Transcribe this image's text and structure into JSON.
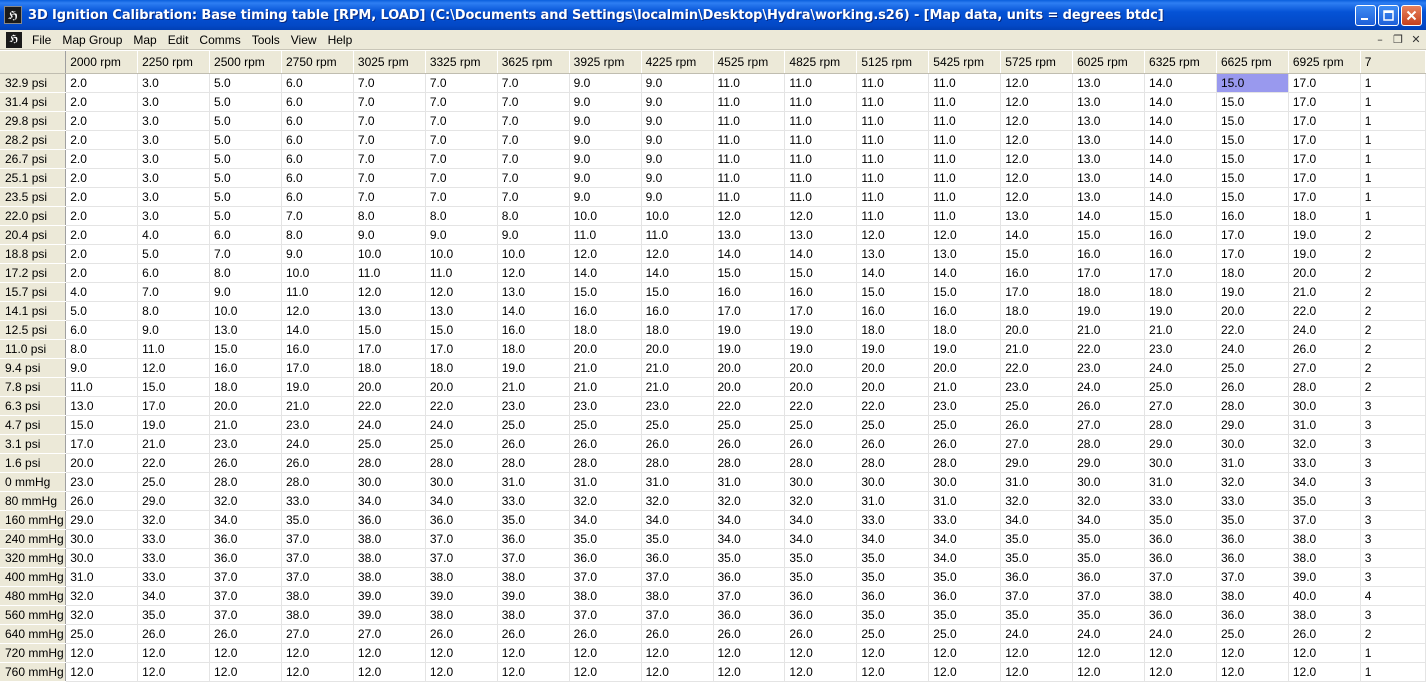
{
  "window": {
    "title": "3D Ignition Calibration: Base timing table [RPM, LOAD]  (C:\\Documents and Settings\\localmin\\Desktop\\Hydra\\working.s26) - [Map data, units = degrees btdc]"
  },
  "menu": [
    "File",
    "Map Group",
    "Map",
    "Edit",
    "Comms",
    "Tools",
    "View",
    "Help"
  ],
  "grid": {
    "columns": [
      "2000 rpm",
      "2250 rpm",
      "2500 rpm",
      "2750 rpm",
      "3025 rpm",
      "3325 rpm",
      "3625 rpm",
      "3925 rpm",
      "4225 rpm",
      "4525 rpm",
      "4825 rpm",
      "5125 rpm",
      "5425 rpm",
      "5725 rpm",
      "6025 rpm",
      "6325 rpm",
      "6625 rpm",
      "6925 rpm",
      "7"
    ],
    "selected": {
      "row": 0,
      "col": 16
    },
    "rows": [
      {
        "label": "32.9 psi",
        "values": [
          "2.0",
          "3.0",
          "5.0",
          "6.0",
          "7.0",
          "7.0",
          "7.0",
          "9.0",
          "9.0",
          "11.0",
          "11.0",
          "11.0",
          "11.0",
          "12.0",
          "13.0",
          "14.0",
          "15.0",
          "17.0",
          "1"
        ]
      },
      {
        "label": "31.4 psi",
        "values": [
          "2.0",
          "3.0",
          "5.0",
          "6.0",
          "7.0",
          "7.0",
          "7.0",
          "9.0",
          "9.0",
          "11.0",
          "11.0",
          "11.0",
          "11.0",
          "12.0",
          "13.0",
          "14.0",
          "15.0",
          "17.0",
          "1"
        ]
      },
      {
        "label": "29.8 psi",
        "values": [
          "2.0",
          "3.0",
          "5.0",
          "6.0",
          "7.0",
          "7.0",
          "7.0",
          "9.0",
          "9.0",
          "11.0",
          "11.0",
          "11.0",
          "11.0",
          "12.0",
          "13.0",
          "14.0",
          "15.0",
          "17.0",
          "1"
        ]
      },
      {
        "label": "28.2 psi",
        "values": [
          "2.0",
          "3.0",
          "5.0",
          "6.0",
          "7.0",
          "7.0",
          "7.0",
          "9.0",
          "9.0",
          "11.0",
          "11.0",
          "11.0",
          "11.0",
          "12.0",
          "13.0",
          "14.0",
          "15.0",
          "17.0",
          "1"
        ]
      },
      {
        "label": "26.7 psi",
        "values": [
          "2.0",
          "3.0",
          "5.0",
          "6.0",
          "7.0",
          "7.0",
          "7.0",
          "9.0",
          "9.0",
          "11.0",
          "11.0",
          "11.0",
          "11.0",
          "12.0",
          "13.0",
          "14.0",
          "15.0",
          "17.0",
          "1"
        ]
      },
      {
        "label": "25.1 psi",
        "values": [
          "2.0",
          "3.0",
          "5.0",
          "6.0",
          "7.0",
          "7.0",
          "7.0",
          "9.0",
          "9.0",
          "11.0",
          "11.0",
          "11.0",
          "11.0",
          "12.0",
          "13.0",
          "14.0",
          "15.0",
          "17.0",
          "1"
        ]
      },
      {
        "label": "23.5 psi",
        "values": [
          "2.0",
          "3.0",
          "5.0",
          "6.0",
          "7.0",
          "7.0",
          "7.0",
          "9.0",
          "9.0",
          "11.0",
          "11.0",
          "11.0",
          "11.0",
          "12.0",
          "13.0",
          "14.0",
          "15.0",
          "17.0",
          "1"
        ]
      },
      {
        "label": "22.0 psi",
        "values": [
          "2.0",
          "3.0",
          "5.0",
          "7.0",
          "8.0",
          "8.0",
          "8.0",
          "10.0",
          "10.0",
          "12.0",
          "12.0",
          "11.0",
          "11.0",
          "13.0",
          "14.0",
          "15.0",
          "16.0",
          "18.0",
          "1"
        ]
      },
      {
        "label": "20.4 psi",
        "values": [
          "2.0",
          "4.0",
          "6.0",
          "8.0",
          "9.0",
          "9.0",
          "9.0",
          "11.0",
          "11.0",
          "13.0",
          "13.0",
          "12.0",
          "12.0",
          "14.0",
          "15.0",
          "16.0",
          "17.0",
          "19.0",
          "2"
        ]
      },
      {
        "label": "18.8 psi",
        "values": [
          "2.0",
          "5.0",
          "7.0",
          "9.0",
          "10.0",
          "10.0",
          "10.0",
          "12.0",
          "12.0",
          "14.0",
          "14.0",
          "13.0",
          "13.0",
          "15.0",
          "16.0",
          "16.0",
          "17.0",
          "19.0",
          "2"
        ]
      },
      {
        "label": "17.2 psi",
        "values": [
          "2.0",
          "6.0",
          "8.0",
          "10.0",
          "11.0",
          "11.0",
          "12.0",
          "14.0",
          "14.0",
          "15.0",
          "15.0",
          "14.0",
          "14.0",
          "16.0",
          "17.0",
          "17.0",
          "18.0",
          "20.0",
          "2"
        ]
      },
      {
        "label": "15.7 psi",
        "values": [
          "4.0",
          "7.0",
          "9.0",
          "11.0",
          "12.0",
          "12.0",
          "13.0",
          "15.0",
          "15.0",
          "16.0",
          "16.0",
          "15.0",
          "15.0",
          "17.0",
          "18.0",
          "18.0",
          "19.0",
          "21.0",
          "2"
        ]
      },
      {
        "label": "14.1 psi",
        "values": [
          "5.0",
          "8.0",
          "10.0",
          "12.0",
          "13.0",
          "13.0",
          "14.0",
          "16.0",
          "16.0",
          "17.0",
          "17.0",
          "16.0",
          "16.0",
          "18.0",
          "19.0",
          "19.0",
          "20.0",
          "22.0",
          "2"
        ]
      },
      {
        "label": "12.5 psi",
        "values": [
          "6.0",
          "9.0",
          "13.0",
          "14.0",
          "15.0",
          "15.0",
          "16.0",
          "18.0",
          "18.0",
          "19.0",
          "19.0",
          "18.0",
          "18.0",
          "20.0",
          "21.0",
          "21.0",
          "22.0",
          "24.0",
          "2"
        ]
      },
      {
        "label": "11.0 psi",
        "values": [
          "8.0",
          "11.0",
          "15.0",
          "16.0",
          "17.0",
          "17.0",
          "18.0",
          "20.0",
          "20.0",
          "19.0",
          "19.0",
          "19.0",
          "19.0",
          "21.0",
          "22.0",
          "23.0",
          "24.0",
          "26.0",
          "2"
        ]
      },
      {
        "label": "9.4 psi",
        "values": [
          "9.0",
          "12.0",
          "16.0",
          "17.0",
          "18.0",
          "18.0",
          "19.0",
          "21.0",
          "21.0",
          "20.0",
          "20.0",
          "20.0",
          "20.0",
          "22.0",
          "23.0",
          "24.0",
          "25.0",
          "27.0",
          "2"
        ]
      },
      {
        "label": "7.8 psi",
        "values": [
          "11.0",
          "15.0",
          "18.0",
          "19.0",
          "20.0",
          "20.0",
          "21.0",
          "21.0",
          "21.0",
          "20.0",
          "20.0",
          "20.0",
          "21.0",
          "23.0",
          "24.0",
          "25.0",
          "26.0",
          "28.0",
          "2"
        ]
      },
      {
        "label": "6.3 psi",
        "values": [
          "13.0",
          "17.0",
          "20.0",
          "21.0",
          "22.0",
          "22.0",
          "23.0",
          "23.0",
          "23.0",
          "22.0",
          "22.0",
          "22.0",
          "23.0",
          "25.0",
          "26.0",
          "27.0",
          "28.0",
          "30.0",
          "3"
        ]
      },
      {
        "label": "4.7 psi",
        "values": [
          "15.0",
          "19.0",
          "21.0",
          "23.0",
          "24.0",
          "24.0",
          "25.0",
          "25.0",
          "25.0",
          "25.0",
          "25.0",
          "25.0",
          "25.0",
          "26.0",
          "27.0",
          "28.0",
          "29.0",
          "31.0",
          "3"
        ]
      },
      {
        "label": "3.1 psi",
        "values": [
          "17.0",
          "21.0",
          "23.0",
          "24.0",
          "25.0",
          "25.0",
          "26.0",
          "26.0",
          "26.0",
          "26.0",
          "26.0",
          "26.0",
          "26.0",
          "27.0",
          "28.0",
          "29.0",
          "30.0",
          "32.0",
          "3"
        ]
      },
      {
        "label": "1.6 psi",
        "values": [
          "20.0",
          "22.0",
          "26.0",
          "26.0",
          "28.0",
          "28.0",
          "28.0",
          "28.0",
          "28.0",
          "28.0",
          "28.0",
          "28.0",
          "28.0",
          "29.0",
          "29.0",
          "30.0",
          "31.0",
          "33.0",
          "3"
        ]
      },
      {
        "label": "0 mmHg",
        "values": [
          "23.0",
          "25.0",
          "28.0",
          "28.0",
          "30.0",
          "30.0",
          "31.0",
          "31.0",
          "31.0",
          "31.0",
          "30.0",
          "30.0",
          "30.0",
          "31.0",
          "30.0",
          "31.0",
          "32.0",
          "34.0",
          "3"
        ]
      },
      {
        "label": "80 mmHg",
        "values": [
          "26.0",
          "29.0",
          "32.0",
          "33.0",
          "34.0",
          "34.0",
          "33.0",
          "32.0",
          "32.0",
          "32.0",
          "32.0",
          "31.0",
          "31.0",
          "32.0",
          "32.0",
          "33.0",
          "33.0",
          "35.0",
          "3"
        ]
      },
      {
        "label": "160 mmHg",
        "values": [
          "29.0",
          "32.0",
          "34.0",
          "35.0",
          "36.0",
          "36.0",
          "35.0",
          "34.0",
          "34.0",
          "34.0",
          "34.0",
          "33.0",
          "33.0",
          "34.0",
          "34.0",
          "35.0",
          "35.0",
          "37.0",
          "3"
        ]
      },
      {
        "label": "240 mmHg",
        "values": [
          "30.0",
          "33.0",
          "36.0",
          "37.0",
          "38.0",
          "37.0",
          "36.0",
          "35.0",
          "35.0",
          "34.0",
          "34.0",
          "34.0",
          "34.0",
          "35.0",
          "35.0",
          "36.0",
          "36.0",
          "38.0",
          "3"
        ]
      },
      {
        "label": "320 mmHg",
        "values": [
          "30.0",
          "33.0",
          "36.0",
          "37.0",
          "38.0",
          "37.0",
          "37.0",
          "36.0",
          "36.0",
          "35.0",
          "35.0",
          "35.0",
          "34.0",
          "35.0",
          "35.0",
          "36.0",
          "36.0",
          "38.0",
          "3"
        ]
      },
      {
        "label": "400 mmHg",
        "values": [
          "31.0",
          "33.0",
          "37.0",
          "37.0",
          "38.0",
          "38.0",
          "38.0",
          "37.0",
          "37.0",
          "36.0",
          "35.0",
          "35.0",
          "35.0",
          "36.0",
          "36.0",
          "37.0",
          "37.0",
          "39.0",
          "3"
        ]
      },
      {
        "label": "480 mmHg",
        "values": [
          "32.0",
          "34.0",
          "37.0",
          "38.0",
          "39.0",
          "39.0",
          "39.0",
          "38.0",
          "38.0",
          "37.0",
          "36.0",
          "36.0",
          "36.0",
          "37.0",
          "37.0",
          "38.0",
          "38.0",
          "40.0",
          "4"
        ]
      },
      {
        "label": "560 mmHg",
        "values": [
          "32.0",
          "35.0",
          "37.0",
          "38.0",
          "39.0",
          "38.0",
          "38.0",
          "37.0",
          "37.0",
          "36.0",
          "36.0",
          "35.0",
          "35.0",
          "35.0",
          "35.0",
          "36.0",
          "36.0",
          "38.0",
          "3"
        ]
      },
      {
        "label": "640 mmHg",
        "values": [
          "25.0",
          "26.0",
          "26.0",
          "27.0",
          "27.0",
          "26.0",
          "26.0",
          "26.0",
          "26.0",
          "26.0",
          "26.0",
          "25.0",
          "25.0",
          "24.0",
          "24.0",
          "24.0",
          "25.0",
          "26.0",
          "2"
        ]
      },
      {
        "label": "720 mmHg",
        "values": [
          "12.0",
          "12.0",
          "12.0",
          "12.0",
          "12.0",
          "12.0",
          "12.0",
          "12.0",
          "12.0",
          "12.0",
          "12.0",
          "12.0",
          "12.0",
          "12.0",
          "12.0",
          "12.0",
          "12.0",
          "12.0",
          "1"
        ]
      },
      {
        "label": "760 mmHg",
        "values": [
          "12.0",
          "12.0",
          "12.0",
          "12.0",
          "12.0",
          "12.0",
          "12.0",
          "12.0",
          "12.0",
          "12.0",
          "12.0",
          "12.0",
          "12.0",
          "12.0",
          "12.0",
          "12.0",
          "12.0",
          "12.0",
          "1"
        ]
      }
    ]
  }
}
